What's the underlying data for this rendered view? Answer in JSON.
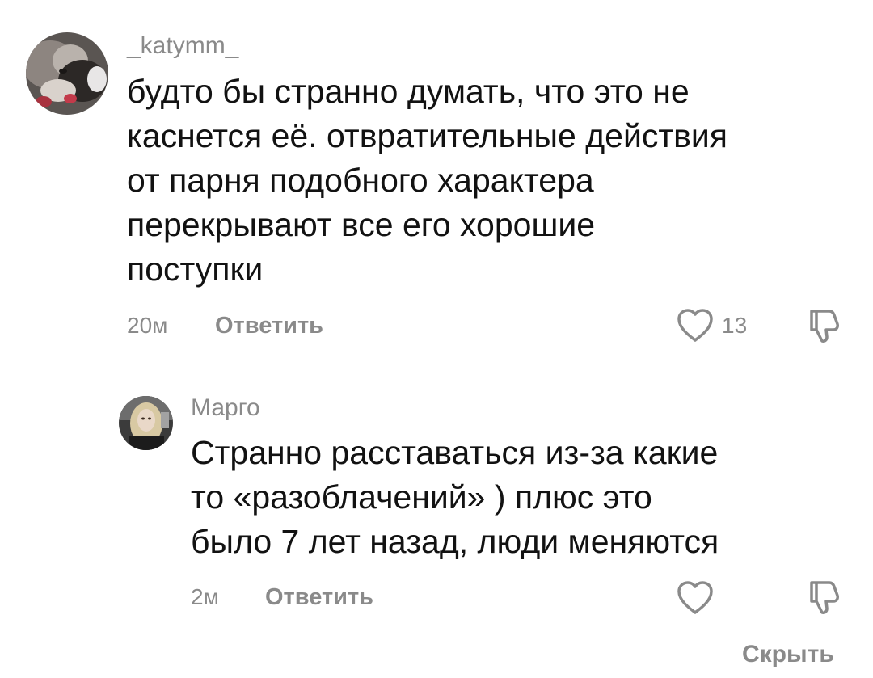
{
  "comments": [
    {
      "username": "_katymm_",
      "avatar": "cat-photo-avatar",
      "lines": [
        "будто бы странно думать, что это не",
        "каснется её. отвратительные действия",
        "от парня подобного характера",
        "перекрывают все его хорошие",
        "поступки"
      ],
      "time": "20м",
      "reply_label": "Ответить",
      "like_count": "13"
    },
    {
      "username": "Марго",
      "avatar": "person-photo-avatar",
      "lines": [
        "Странно расставаться из-за какие",
        "то «разоблачений» ) плюс это",
        "было 7 лет назад, люди меняются"
      ],
      "time": "2м",
      "reply_label": "Ответить",
      "like_count": ""
    }
  ],
  "hide_label": "Скрыть",
  "colors": {
    "text": "#121212",
    "muted": "#8a8a8a",
    "background": "#ffffff"
  }
}
